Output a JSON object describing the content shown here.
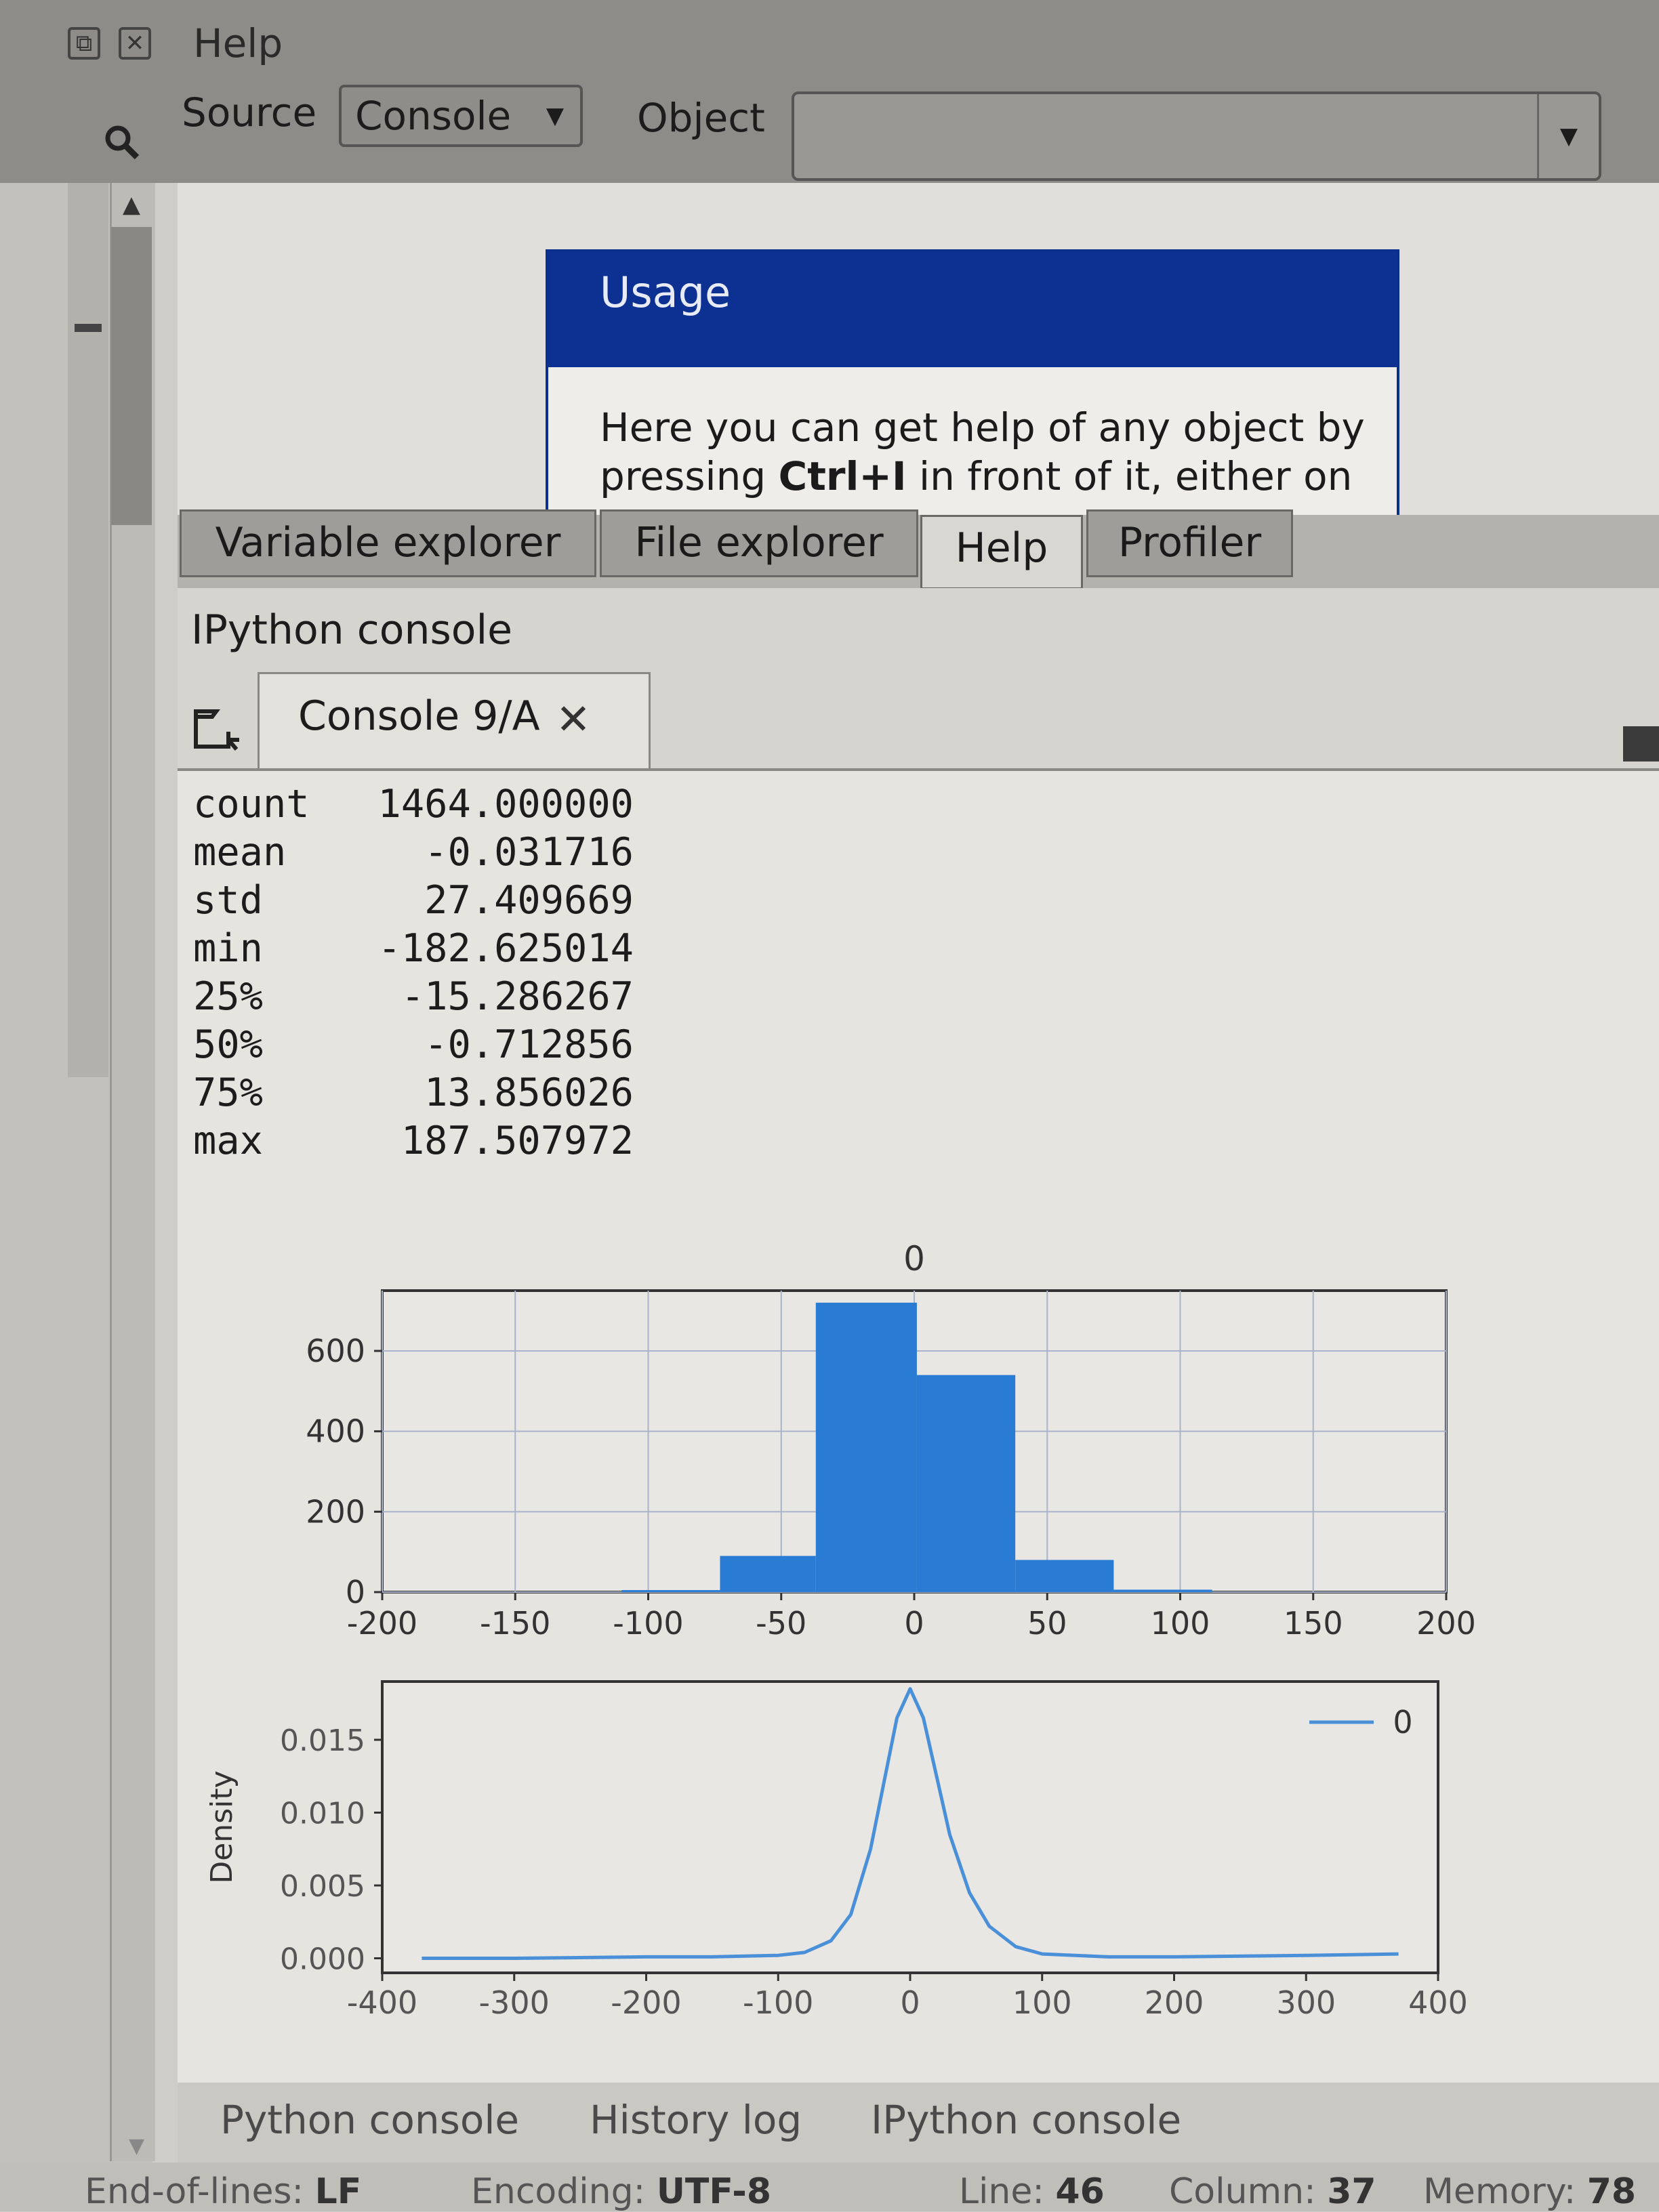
{
  "window": {
    "title": "Help"
  },
  "help_toolbar": {
    "source_label": "Source",
    "source_value": "Console",
    "object_label": "Object",
    "object_value": ""
  },
  "usage": {
    "title": "Usage",
    "line1": "Here you can get help of any object by",
    "line2_pre": "pressing ",
    "line2_key": "Ctrl+I",
    "line2_post": " in front of it, either on"
  },
  "pane_tabs": [
    "Variable explorer",
    "File explorer",
    "Help",
    "Profiler"
  ],
  "ipython": {
    "label": "IPython console",
    "tab_label": "Console 9/A"
  },
  "stats": [
    {
      "k": "count",
      "v": "1464.000000"
    },
    {
      "k": "mean",
      "v": "-0.031716"
    },
    {
      "k": "std",
      "v": "27.409669"
    },
    {
      "k": "min",
      "v": "-182.625014"
    },
    {
      "k": "25%",
      "v": "-15.286267"
    },
    {
      "k": "50%",
      "v": "-0.712856"
    },
    {
      "k": "75%",
      "v": "13.856026"
    },
    {
      "k": "max",
      "v": "187.507972"
    }
  ],
  "chart_data": [
    {
      "type": "bar",
      "title": "0",
      "xlim": [
        -200,
        200
      ],
      "ylim": [
        0,
        750
      ],
      "xticks": [
        -200,
        -150,
        -100,
        -50,
        0,
        50,
        100,
        150,
        200
      ],
      "yticks": [
        0,
        200,
        400,
        600
      ],
      "grid": true,
      "bins": [
        {
          "x0": -110,
          "x1": -73,
          "count": 5
        },
        {
          "x0": -73,
          "x1": -37,
          "count": 90
        },
        {
          "x0": -37,
          "x1": 1,
          "count": 720
        },
        {
          "x0": 1,
          "x1": 38,
          "count": 540
        },
        {
          "x0": 38,
          "x1": 75,
          "count": 80
        },
        {
          "x0": 75,
          "x1": 112,
          "count": 6
        }
      ],
      "color": "#2a7bd4"
    },
    {
      "type": "line",
      "ylabel": "Density",
      "xlim": [
        -400,
        400
      ],
      "ylim": [
        -0.001,
        0.019
      ],
      "xticks": [
        -400,
        -300,
        -200,
        -100,
        0,
        100,
        200,
        300,
        400
      ],
      "yticks": [
        "0.000",
        "0.005",
        "0.010",
        "0.015"
      ],
      "legend": {
        "entry": "0",
        "placement": "top-right"
      },
      "series": [
        {
          "name": "0",
          "color": "#4a90d9",
          "x": [
            -370,
            -300,
            -200,
            -150,
            -100,
            -80,
            -60,
            -45,
            -30,
            -20,
            -10,
            0,
            10,
            20,
            30,
            45,
            60,
            80,
            100,
            150,
            200,
            300,
            370
          ],
          "y": [
            0.0,
            0.0,
            0.0001,
            0.0001,
            0.0002,
            0.0004,
            0.0012,
            0.003,
            0.0075,
            0.012,
            0.0165,
            0.0185,
            0.0165,
            0.0125,
            0.0085,
            0.0045,
            0.0022,
            0.0008,
            0.0003,
            0.0001,
            0.0001,
            0.0002,
            0.0003
          ]
        }
      ]
    }
  ],
  "bottom_tabs": [
    "Python console",
    "History log",
    "IPython console"
  ],
  "status": {
    "eol_label": "End-of-lines:",
    "eol_value": "LF",
    "enc_label": "Encoding:",
    "enc_value": "UTF-8",
    "line_label": "Line:",
    "line_value": "46",
    "col_label": "Column:",
    "col_value": "37",
    "mem_label": "Memory:",
    "mem_value": "78"
  }
}
